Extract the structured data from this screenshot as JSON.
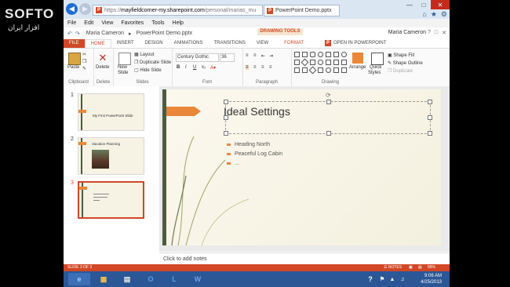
{
  "watermark": {
    "brand": "SOFTO",
    "subtitle": "افزار ایران"
  },
  "browser": {
    "address_prefix": "https://",
    "address_domain": "mayfieldcorner-my.sharepoint.com",
    "address_rest": "/personal/marias_mu",
    "tab_title": "PowerPoint Demo.pptx",
    "menu": [
      "File",
      "Edit",
      "View",
      "Favorites",
      "Tools",
      "Help"
    ]
  },
  "ppt": {
    "breadcrumb_owner": "Maria Cameron",
    "breadcrumb_file": "PowerPoint Demo.pptx",
    "drawing_tools": "DRAWING TOOLS",
    "user": "Maria Cameron",
    "tabs": [
      "FILE",
      "HOME",
      "INSERT",
      "DESIGN",
      "ANIMATIONS",
      "TRANSITIONS",
      "VIEW",
      "FORMAT",
      "OPEN IN POWERPOINT"
    ],
    "ribbon": {
      "paste": "Paste",
      "delete": "Delete",
      "new_slide_1": "New",
      "new_slide_2": "Slide",
      "layout": "Layout",
      "duplicate": "Duplicate Slide",
      "hide": "Hide Slide",
      "font_name": "Century Gothic",
      "font_size": "36",
      "shape_fill": "Shape Fill",
      "shape_outline": "Shape Outline",
      "duplicate_shape": "Duplicate",
      "arrange": "Arrange",
      "quick_styles_1": "Quick",
      "quick_styles_2": "Styles",
      "groups": [
        "Clipboard",
        "Delete",
        "Slides",
        "Font",
        "Paragraph",
        "Drawing"
      ]
    },
    "thumbnails": [
      {
        "num": "1",
        "title": "My First PowerPoint Slide"
      },
      {
        "num": "2",
        "title": "Vacation Planning"
      },
      {
        "num": "3",
        "title": ""
      }
    ],
    "slide": {
      "title": "Ideal Settings",
      "bullets": [
        "Heading North",
        "Peaceful Log Cabin",
        "..."
      ]
    },
    "notes_placeholder": "Click to add notes",
    "status_left": "SLIDE 3 OF 3",
    "status_notes": "NOTES",
    "status_zoom": "88%"
  },
  "taskbar": {
    "time": "9:06 AM",
    "date": "4/25/2013"
  },
  "colors": {
    "accent": "#d24726",
    "orange": "#e9883a",
    "taskbar": "#2b5797"
  }
}
